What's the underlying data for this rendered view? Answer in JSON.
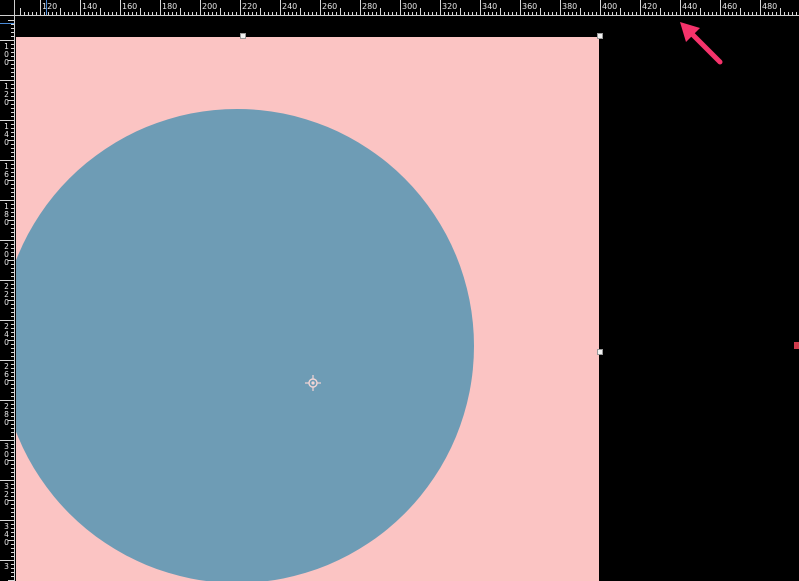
{
  "ruler": {
    "top_labels": [
      "120",
      "140",
      "160",
      "180",
      "200",
      "220",
      "240",
      "260",
      "280",
      "300",
      "320",
      "340",
      "360",
      "380",
      "400",
      "420",
      "440",
      "460",
      "480"
    ],
    "left_labels": [
      "100",
      "120",
      "140",
      "160",
      "180",
      "200",
      "220",
      "240",
      "260",
      "280",
      "300",
      "320",
      "340",
      "3"
    ]
  },
  "colors": {
    "artboard": "#fbc4c3",
    "circle": "#6e9cb5",
    "annotation_arrow": "#f5336b",
    "background": "#000000"
  },
  "icons": {
    "anchor": "crosshair-icon",
    "annotation": "arrow-icon"
  }
}
